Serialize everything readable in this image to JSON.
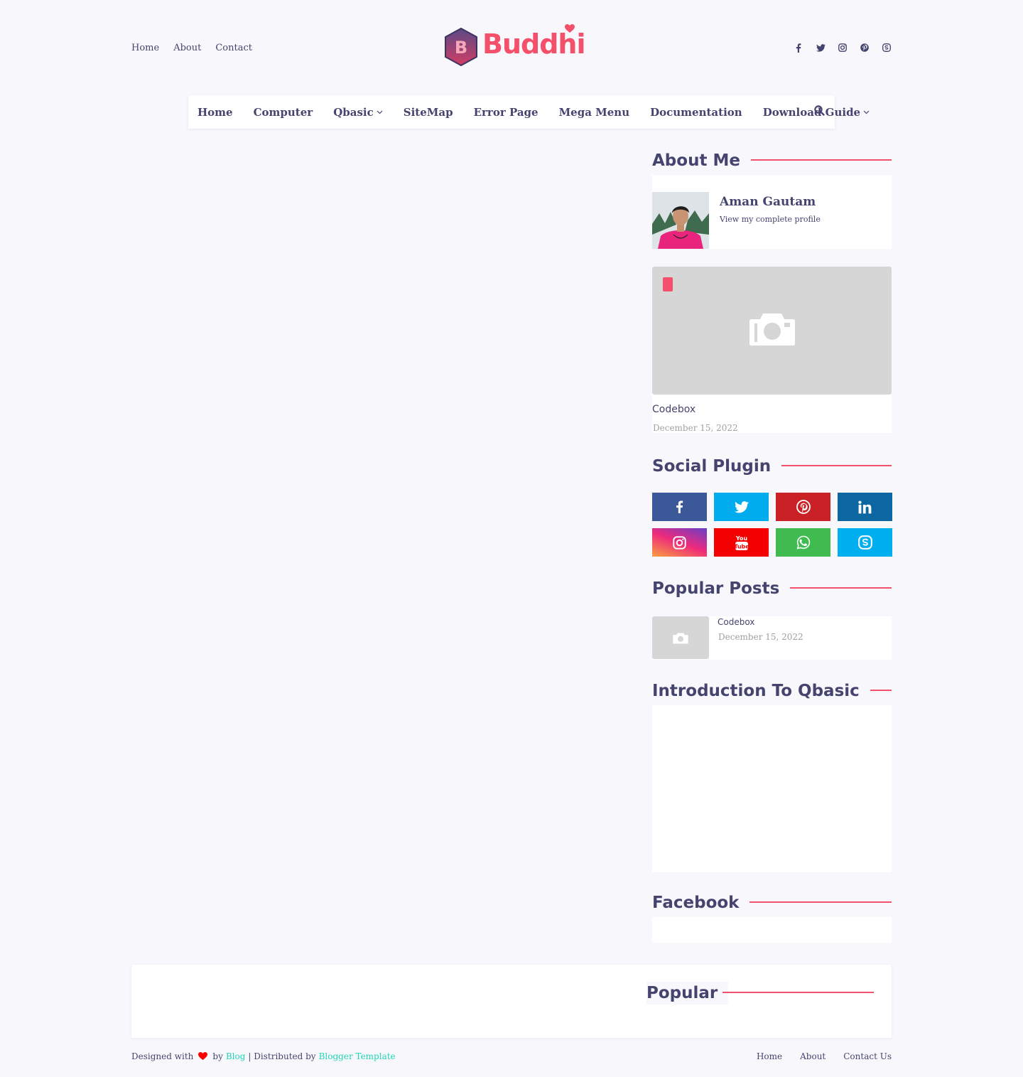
{
  "header": {
    "top_links": [
      "Home",
      "About",
      "Contact"
    ],
    "logo_letter": "B",
    "logo_text": "Buddhi",
    "social_icons": [
      "facebook-icon",
      "twitter-icon",
      "instagram-icon",
      "pinterest-icon",
      "skype-icon"
    ]
  },
  "nav": {
    "items": [
      {
        "label": "Home",
        "dropdown": false
      },
      {
        "label": "Computer",
        "dropdown": false
      },
      {
        "label": "Qbasic",
        "dropdown": true
      },
      {
        "label": "SiteMap",
        "dropdown": false
      },
      {
        "label": "Error Page",
        "dropdown": false
      },
      {
        "label": "Mega Menu",
        "dropdown": false
      },
      {
        "label": "Documentation",
        "dropdown": false
      },
      {
        "label": "Download Guide",
        "dropdown": true
      }
    ],
    "search_icon": "search-icon"
  },
  "about": {
    "title": "About Me",
    "name": "Aman Gautam",
    "link": "View my complete profile"
  },
  "featured": {
    "title": "Codebox",
    "date": "December 15, 2022"
  },
  "social_plugin": {
    "title": "Social Plugin",
    "buttons": [
      {
        "name": "facebook",
        "color": "#3b5998"
      },
      {
        "name": "twitter",
        "color": "#00acee"
      },
      {
        "name": "pinterest",
        "color": "#ca2127"
      },
      {
        "name": "linkedin",
        "color": "#0b66a2"
      },
      {
        "name": "instagram",
        "color": "#dd2a7b"
      },
      {
        "name": "youtube",
        "color": "#f50000"
      },
      {
        "name": "whatsapp",
        "color": "#3fbb50"
      },
      {
        "name": "skype",
        "color": "#00aff0"
      }
    ]
  },
  "popular_posts": {
    "title": "Popular Posts",
    "items": [
      {
        "title": "Codebox",
        "date": "December 15, 2022"
      }
    ]
  },
  "intro": {
    "title": "Introduction To Qbasic"
  },
  "facebook": {
    "title": "Facebook"
  },
  "footer": {
    "popular_title": "Popular",
    "designed_with": "Designed with",
    "by": "by",
    "blog": "Blog",
    "distributed_by": "| Distributed by",
    "blogger_template": "Blogger Template",
    "links": [
      "Home",
      "About",
      "Contact Us"
    ]
  },
  "colors": {
    "accent": "#f4506b",
    "text": "#45446e",
    "background": "#f8f8fc",
    "footer_link": "#1fd5b6"
  }
}
